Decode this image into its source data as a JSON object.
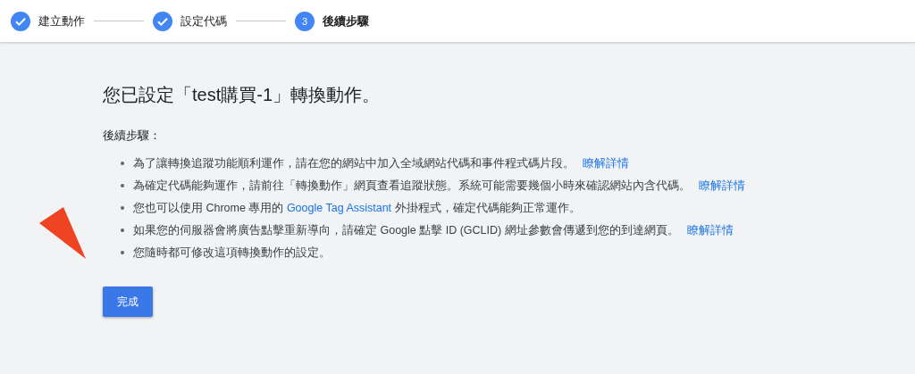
{
  "stepper": [
    {
      "label": "建立動作",
      "completed": true,
      "selected": false
    },
    {
      "label": "設定代碼",
      "completed": true,
      "selected": false
    },
    {
      "label": "後續步驟",
      "completed": false,
      "selected": true,
      "number": "3"
    }
  ],
  "title": "您已設定「test購買-1」轉換動作。",
  "subheading": "後續步驟：",
  "items": [
    {
      "parts": [
        {
          "kind": "text",
          "text": "為了讓轉換追蹤功能順利運作，請在您的網站中加入全域網站代碼和事件程式碼片段。"
        },
        {
          "kind": "trail_link",
          "text": "瞭解詳情"
        }
      ]
    },
    {
      "parts": [
        {
          "kind": "text",
          "text": "為確定代碼能夠運作，請前往「轉換動作」網頁查看追蹤狀態。系統可能需要幾個小時來確認網站內含代碼。"
        },
        {
          "kind": "trail_link",
          "text": "瞭解詳情"
        }
      ]
    },
    {
      "parts": [
        {
          "kind": "text",
          "text": "您也可以使用 Chrome 專用的 "
        },
        {
          "kind": "link",
          "text": "Google Tag Assistant"
        },
        {
          "kind": "text",
          "text": " 外掛程式，確定代碼能夠正常運作。"
        }
      ]
    },
    {
      "parts": [
        {
          "kind": "text",
          "text": "如果您的伺服器會將廣告點擊重新導向，請確定 Google 點擊 ID (GCLID) 網址參數會傳遞到您的到達網頁。"
        },
        {
          "kind": "trail_link",
          "text": "瞭解詳情"
        }
      ]
    },
    {
      "parts": [
        {
          "kind": "text",
          "text": "您隨時都可修改這項轉換動作的設定。"
        }
      ]
    }
  ],
  "button": "完成"
}
